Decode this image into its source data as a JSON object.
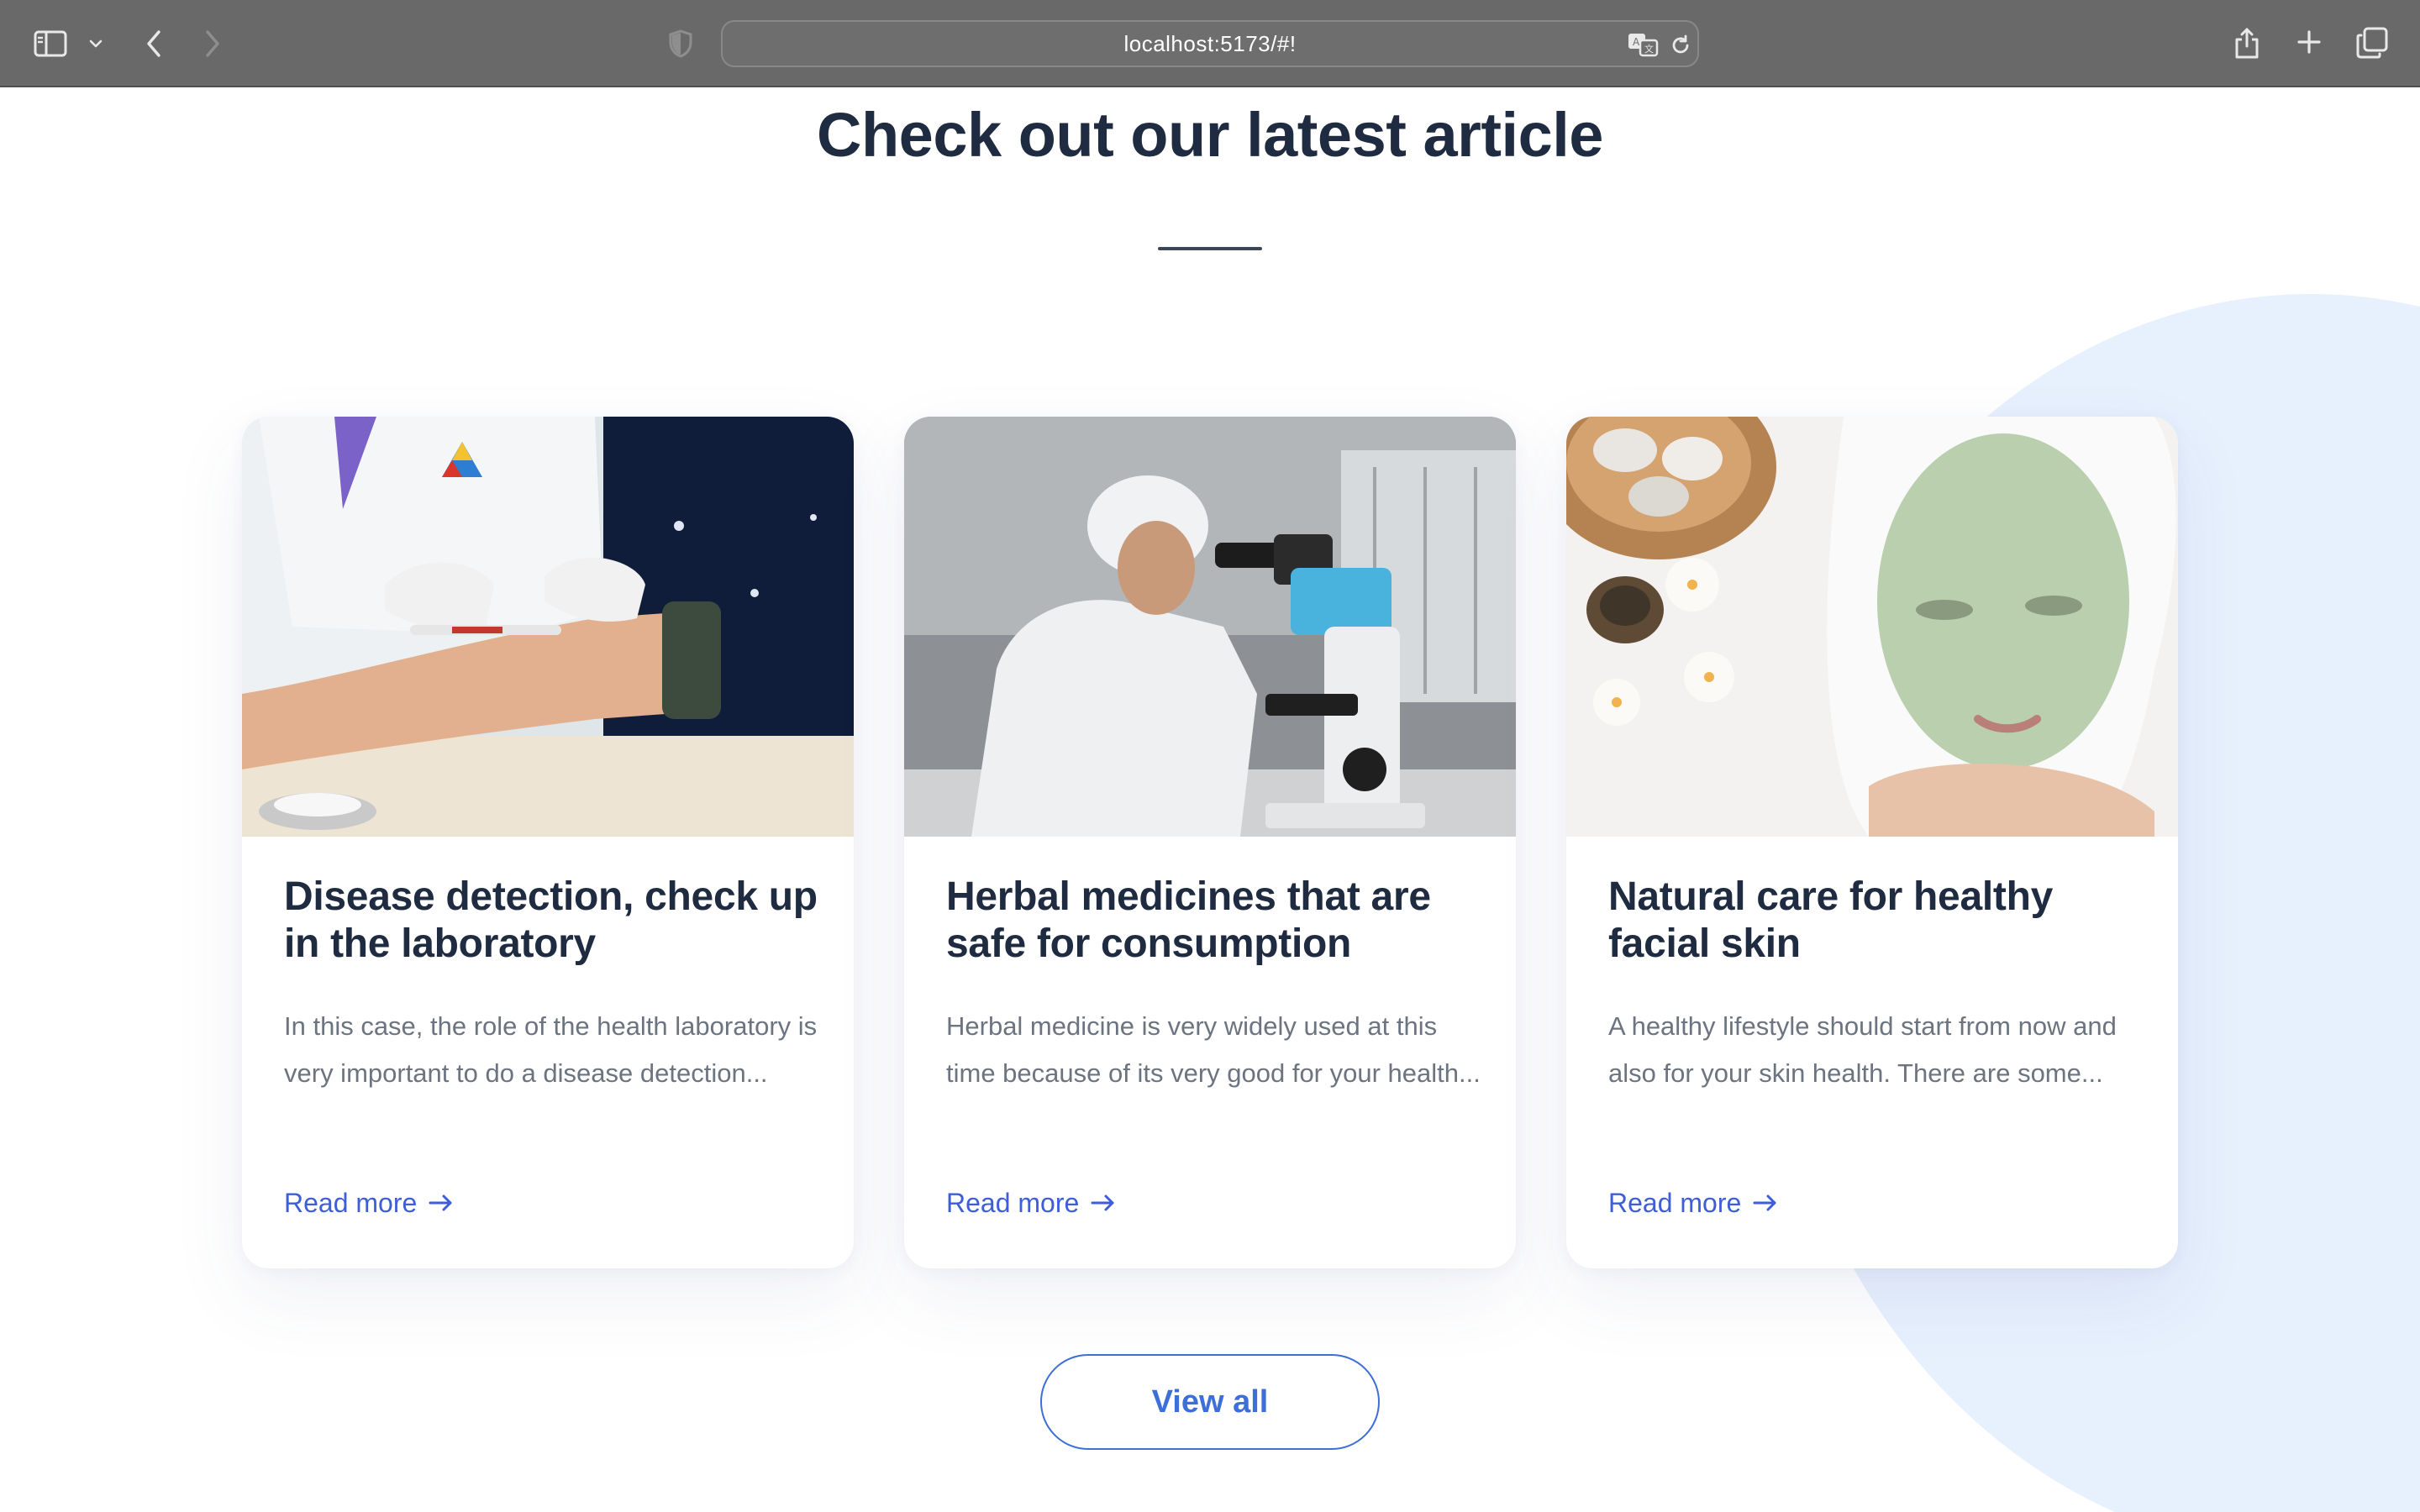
{
  "browser": {
    "url": "localhost:5173/#!"
  },
  "section": {
    "title": "Check out our latest article"
  },
  "articles": [
    {
      "title": "Disease detection, check up in the laboratory",
      "description": "In this case, the role of the health laboratory is very important to do a disease detection...",
      "link_label": "Read more"
    },
    {
      "title": "Herbal medicines that are safe for consumption",
      "description": "Herbal medicine is very widely used at this time because of its very good for your health...",
      "link_label": "Read more"
    },
    {
      "title": "Natural care for healthy facial skin",
      "description": "A healthy lifestyle should start from now and also for your skin health. There are some...",
      "link_label": "Read more"
    }
  ],
  "view_all_label": "View all",
  "colors": {
    "heading": "#1f2b40",
    "body_text": "#6c7480",
    "link": "#3d5ed8",
    "button": "#3d6fd8",
    "blob": "#e7f0fd",
    "chrome": "#696969"
  }
}
